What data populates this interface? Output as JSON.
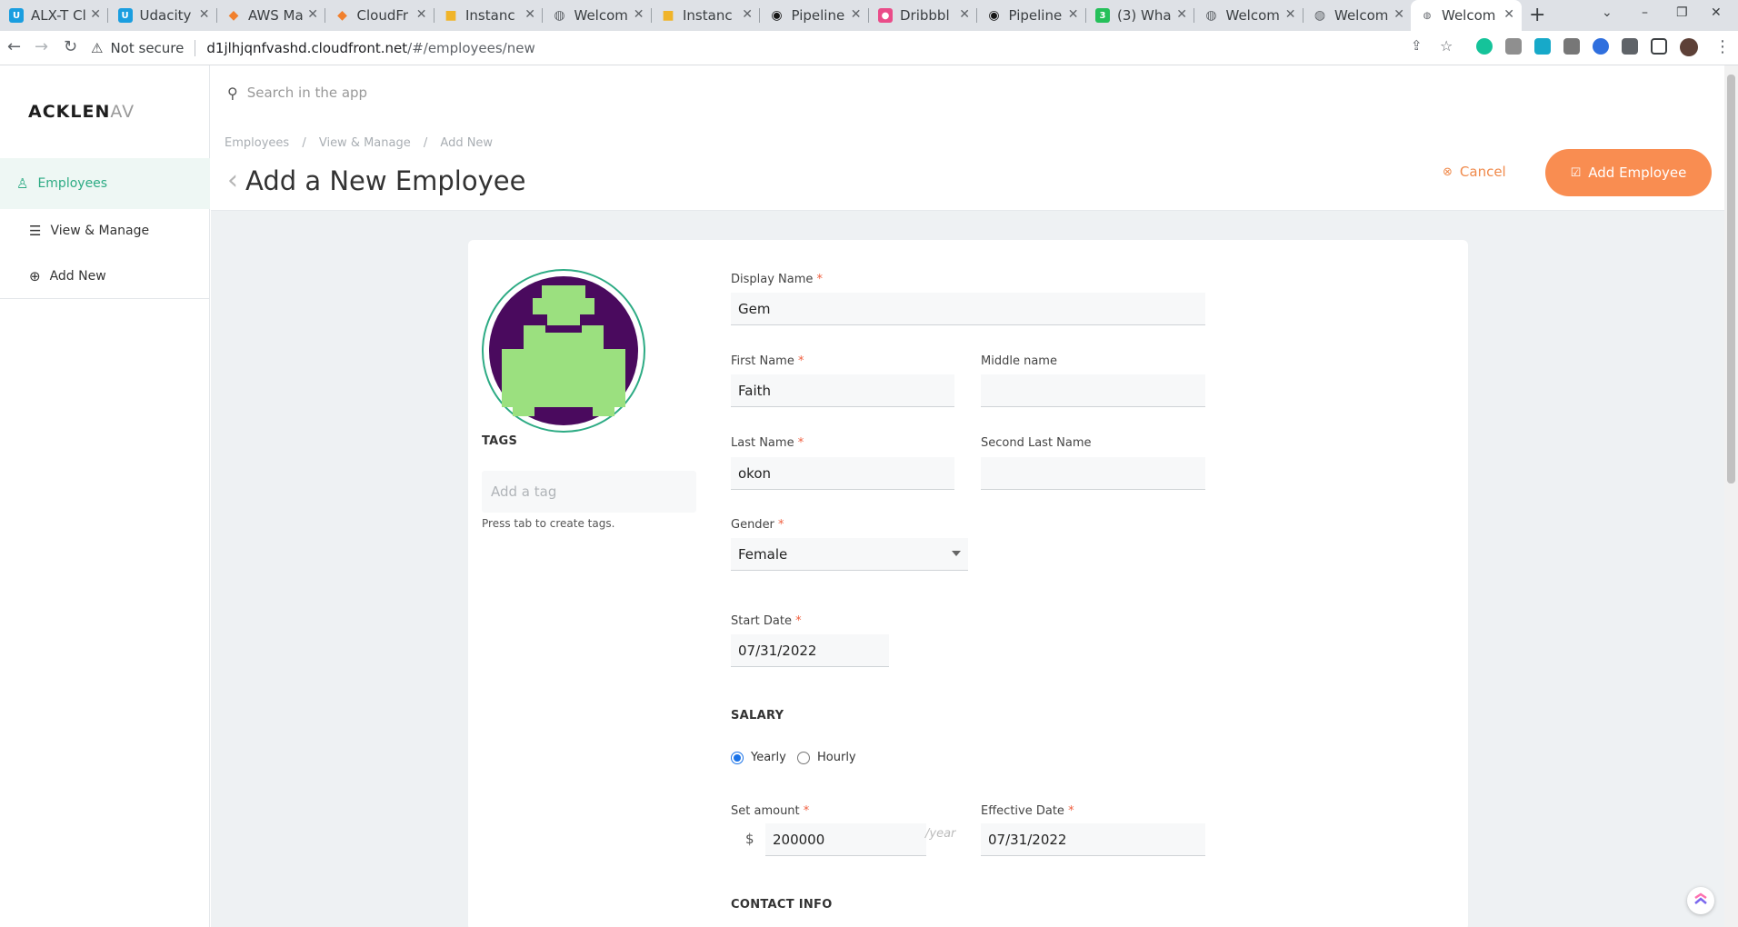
{
  "browser": {
    "tabs": [
      {
        "title": "ALX-T Cl",
        "icon": "udacity-icon",
        "color": "#1a9ee0"
      },
      {
        "title": "Udacity",
        "icon": "udacity-icon",
        "color": "#1a9ee0"
      },
      {
        "title": "AWS Ma",
        "icon": "aws-icon",
        "color": "#f1802d"
      },
      {
        "title": "CloudFr",
        "icon": "aws-icon",
        "color": "#f1802d"
      },
      {
        "title": "Instanc",
        "icon": "box-icon",
        "color": "#f0b429"
      },
      {
        "title": "Welcom",
        "icon": "globe-icon",
        "color": "#5f6368"
      },
      {
        "title": "Instanc",
        "icon": "box-icon",
        "color": "#f0b429"
      },
      {
        "title": "Pipeline",
        "icon": "circleci-icon",
        "color": "#161616"
      },
      {
        "title": "Dribbbl",
        "icon": "dribbble-icon",
        "color": "#ea4c89"
      },
      {
        "title": "Pipeline",
        "icon": "circleci-icon",
        "color": "#161616"
      },
      {
        "title": "(3) Wha",
        "icon": "green-badge-icon",
        "color": "#25c05a"
      },
      {
        "title": "Welcom",
        "icon": "globe-icon",
        "color": "#5f6368"
      },
      {
        "title": "Welcom",
        "icon": "globe-icon",
        "color": "#5f6368"
      },
      {
        "title": "Welcom",
        "icon": "globe-icon",
        "color": "#5f6368"
      }
    ],
    "security": "Not secure",
    "url_host": "d1jlhjqnfvashd.cloudfront.net",
    "url_path": "/#/employees/new"
  },
  "app": {
    "logo_bold": "ACKLEN",
    "logo_fade": "AV",
    "search_placeholder": "Search in the app",
    "sidebar": [
      {
        "label": "Employees",
        "icon": "user-icon"
      },
      {
        "label": "View & Manage",
        "icon": "list-icon"
      },
      {
        "label": "Add New",
        "icon": "plus-circle-icon"
      }
    ],
    "breadcrumbs": [
      "Employees",
      "/",
      "View & Manage",
      "/",
      "Add New"
    ],
    "page_title": "Add a New Employee",
    "cancel_label": "Cancel",
    "add_label": "Add Employee",
    "accent": "#2dab84",
    "cta_color": "#f98d51"
  },
  "form": {
    "tags_title": "TAGS",
    "tag_placeholder": "Add a tag",
    "tag_help": "Press tab to create tags.",
    "display_name_label": "Display Name",
    "display_name": "Gem",
    "first_name_label": "First Name",
    "first_name": "Faith",
    "middle_name_label": "Middle name",
    "middle_name": "",
    "last_name_label": "Last Name",
    "last_name": "okon",
    "second_last_name_label": "Second Last Name",
    "second_last_name": "",
    "gender_label": "Gender",
    "gender": "Female",
    "start_date_label": "Start Date",
    "start_date": "07/31/2022",
    "salary_title": "SALARY",
    "salary_options": [
      "Yearly",
      "Hourly"
    ],
    "salary_selected": "Yearly",
    "amount_label": "Set amount",
    "currency": "$",
    "amount": "200000",
    "per": "/year",
    "effective_date_label": "Effective Date",
    "effective_date": "07/31/2022",
    "contact_title": "CONTACT INFO",
    "required_mark": "*"
  }
}
